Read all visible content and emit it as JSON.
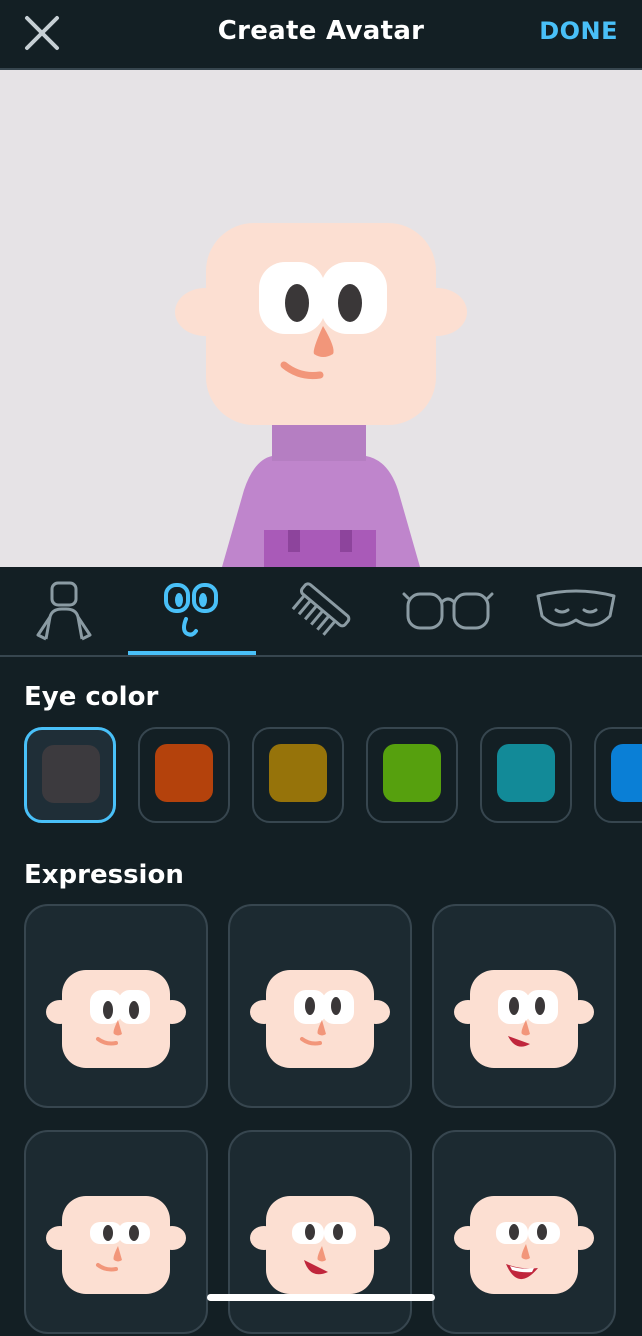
{
  "header": {
    "title": "Create Avatar",
    "done_label": "DONE",
    "close_icon": "close-icon"
  },
  "tabs": [
    {
      "icon": "body-icon",
      "active": false
    },
    {
      "icon": "face-icon",
      "active": true
    },
    {
      "icon": "comb-icon",
      "active": false
    },
    {
      "icon": "glasses-icon",
      "active": false
    },
    {
      "icon": "mustache-icon",
      "active": false
    }
  ],
  "eye_color": {
    "title": "Eye color",
    "swatches": [
      "#3c3a3e",
      "#b4420c",
      "#96730a",
      "#56a00e",
      "#128a98",
      "#0a7fd6"
    ],
    "selected_index": 0
  },
  "expression": {
    "title": "Expression",
    "selected_index": 0
  },
  "colors": {
    "accent": "#49c0f8",
    "background": "#131f24",
    "skin": "#fcdfd2",
    "shirt": "#bf85cc"
  }
}
